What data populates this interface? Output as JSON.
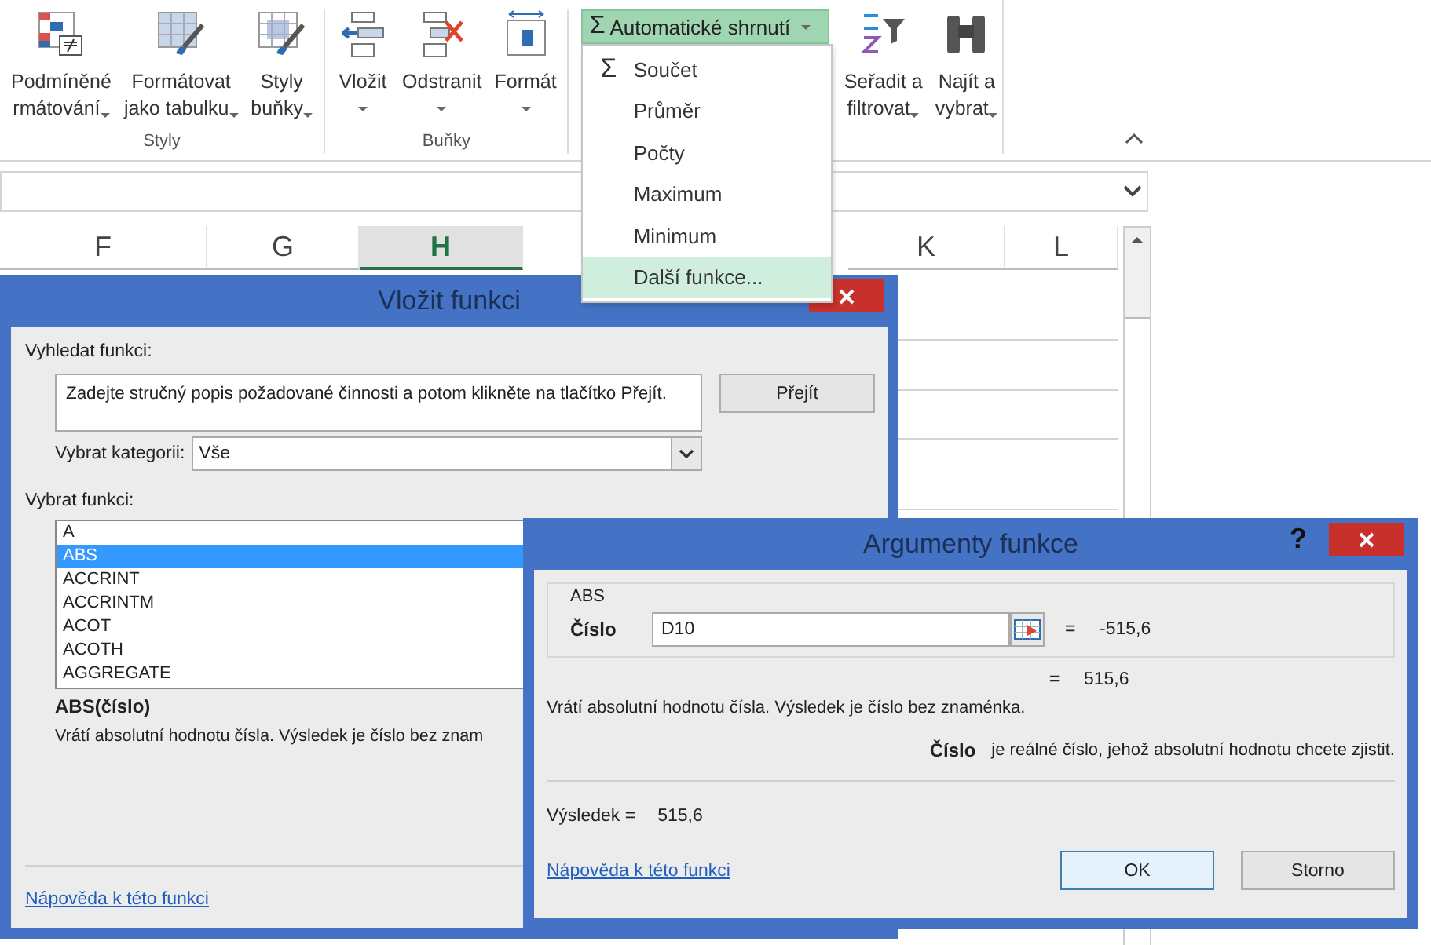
{
  "ribbon": {
    "groups": [
      {
        "label": "Styly",
        "buttons": [
          {
            "lines": [
              "Podmíněné",
              "rmátování"
            ],
            "kind": "conditional",
            "dropdown": true
          },
          {
            "lines": [
              "Formátovat",
              "jako tabulku"
            ],
            "kind": "table",
            "dropdown": true
          },
          {
            "lines": [
              "Styly",
              "buňky"
            ],
            "kind": "cellstyle",
            "dropdown": true
          }
        ]
      },
      {
        "label": "Buňky",
        "buttons": [
          {
            "lines": [
              "Vložit"
            ],
            "kind": "insert",
            "dropdown": true
          },
          {
            "lines": [
              "Odstranit"
            ],
            "kind": "delete",
            "dropdown": true
          },
          {
            "lines": [
              "Formát"
            ],
            "kind": "format",
            "dropdown": true
          }
        ]
      }
    ],
    "autosum": {
      "icon": "Σ",
      "label": "Automatické shrnutí",
      "expanded": true
    },
    "editing_buttons": [
      {
        "lines": [
          "Seřadit a",
          "filtrovat"
        ],
        "kind": "sort",
        "dropdown": true
      },
      {
        "lines": [
          "Najít a",
          "vybrat"
        ],
        "kind": "find",
        "dropdown": true
      }
    ]
  },
  "autosum_menu": [
    {
      "icon": "Σ",
      "label": "Součet",
      "selected": false
    },
    {
      "label": "Průměr",
      "selected": false
    },
    {
      "label": "Počty",
      "selected": false
    },
    {
      "label": "Maximum",
      "selected": false
    },
    {
      "label": "Minimum",
      "selected": false
    },
    {
      "label": "Další funkce...",
      "selected": true
    }
  ],
  "sheet": {
    "columns": [
      {
        "label": "F",
        "selected": false
      },
      {
        "label": "G",
        "selected": false
      },
      {
        "label": "H",
        "selected": true
      },
      {
        "label": "K",
        "selected": false
      },
      {
        "label": "L",
        "selected": false
      }
    ]
  },
  "insert_function_dialog": {
    "title": "Vložit funkci",
    "search_label": "Vyhledat funkci:",
    "search_value": "Zadejte stručný popis požadované činnosti a potom klikněte na tlačítko Přejít.",
    "go_button": "Přejít",
    "category_label": "Vybrat kategorii:",
    "category_value": "Vše",
    "function_label": "Vybrat funkci:",
    "functions": [
      {
        "name": "A",
        "selected": false
      },
      {
        "name": "ABS",
        "selected": true
      },
      {
        "name": "ACCRINT",
        "selected": false
      },
      {
        "name": "ACCRINTM",
        "selected": false
      },
      {
        "name": "ACOT",
        "selected": false
      },
      {
        "name": "ACOTH",
        "selected": false
      },
      {
        "name": "AGGREGATE",
        "selected": false
      }
    ],
    "syntax": "ABS(číslo)",
    "description": "Vrátí absolutní hodnotu čísla. Výsledek je číslo bez znam",
    "help_link": "Nápověda k této funkci"
  },
  "function_arguments_dialog": {
    "title": "Argumenty funkce",
    "help_button": "?",
    "group_label": "ABS",
    "argument_label": "Číslo",
    "argument_value": "D10",
    "equals_sign": "=",
    "argument_result": "-515,6",
    "formula_equals": "=",
    "formula_result": "515,6",
    "description": "Vrátí absolutní hodnotu čísla. Výsledek je číslo bez znaménka.",
    "argument_help_label": "Číslo",
    "argument_help": "je reálné číslo, jehož absolutní hodnotu chcete zjistit.",
    "result_label": "Výsledek =",
    "result_value": "515,6",
    "help_link": "Nápověda k této funkci",
    "buttons": [
      {
        "label": "OK",
        "default": true
      },
      {
        "label": "Storno",
        "default": false
      }
    ]
  }
}
